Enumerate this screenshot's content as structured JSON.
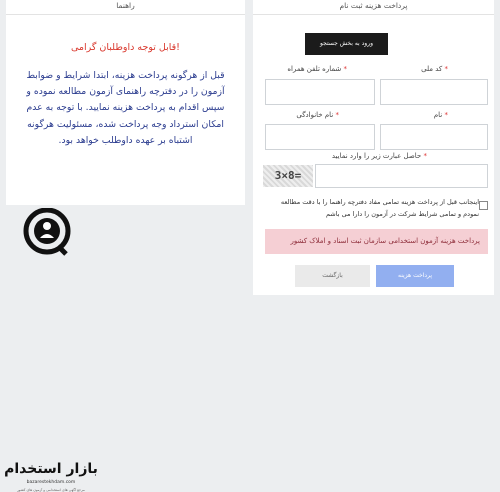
{
  "guide": {
    "header": "راهنما",
    "title": "قابل توجه داوطلبان گرامی!",
    "body": "قبل از هرگونه پرداخت هزینه، ابتدا شرایط و ضوابط آزمون را در دفترچه راهنمای آزمون مطالعه نموده و سپس اقدام به پرداخت هزینه نمایید. با توجه به عدم امکان استرداد وجه پرداخت شده، مسئولیت هرگونه اشتباه بر عهده داوطلب خواهد بود."
  },
  "form": {
    "header": "پرداخت هزینه ثبت نام",
    "search_button": "ورود به بخش جستجو",
    "fields": {
      "national_code": "کد ملی",
      "mobile": "شماره تلفن همراه",
      "first_name": "نام",
      "last_name": "نام خانوادگی",
      "captcha": "حاصل عبارت زیر را وارد نمایید"
    },
    "required_mark": "*",
    "captcha_image": "3×8=",
    "agree_text": "اینجانب قبل از پرداخت هزینه تمامی مفاد دفترچه راهنما را با دقت مطالعه نمودم و تمامی شرایط شرکت در آزمون را دارا می باشم",
    "alert": "پرداخت هزینه آزمون استخدامی سازمان ثبت اسناد و املاک کشور",
    "pay_button": "پرداخت هزینه",
    "back_button": "بازگشت"
  },
  "logo": {
    "name": "بازار استخدام",
    "url": "bazarestekhdam.com",
    "tagline": "مرجع آگهی های استخدامی و آزمون های کشور"
  },
  "colors": {
    "title_red": "#d9362b",
    "body_blue": "#2b3c8f",
    "alert_bg": "#f5cfd4",
    "pay_btn": "#92aff0"
  }
}
